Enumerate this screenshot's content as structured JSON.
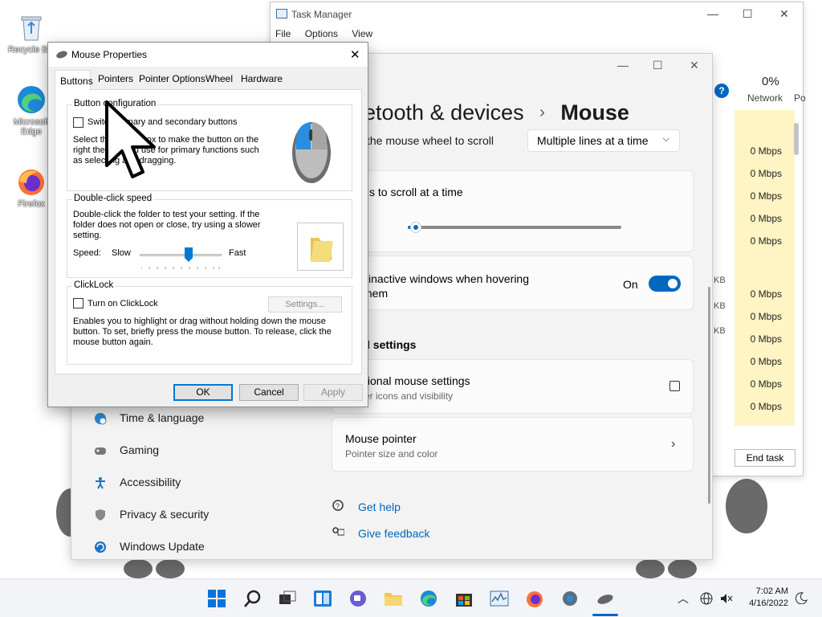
{
  "desktop": {
    "icons": [
      {
        "label": "Recycle Bin",
        "icon": "recycle-bin-icon"
      },
      {
        "label": "Microsoft Edge",
        "icon": "edge-icon"
      },
      {
        "label": "Firefox",
        "icon": "firefox-icon"
      }
    ]
  },
  "task_manager": {
    "title": "Task Manager",
    "menu": [
      "File",
      "Options",
      "View"
    ],
    "network_percent": "0%",
    "network_label": "Network",
    "next_col": "Po",
    "cells": [
      "0 Mbps",
      "0 Mbps",
      "0 Mbps",
      "0 Mbps",
      "0 Mbps",
      "0 Mbps",
      "0 Mbps",
      "0 Mbps",
      "0 Mbps",
      "0 Mbps",
      "0 Mbps"
    ],
    "kb_labels": [
      "KB",
      "KB",
      "KB"
    ],
    "end_task": "End task"
  },
  "settings": {
    "breadcrumb_parent": "etooth & devices",
    "breadcrumb_sep": "›",
    "page_title": "Mouse",
    "scroll_mode_label": "the mouse wheel to scroll",
    "scroll_mode_value": "Multiple lines at a time",
    "lines_label": "s to scroll at a time",
    "lines_slider": 0.05,
    "inactive_label_1": "l inactive windows when hovering",
    "inactive_label_2": "them",
    "inactive_state": "On",
    "related_heading": "l settings",
    "additional_title": "tional mouse settings",
    "additional_sub": "er icons and visibility",
    "pointer_title": "Mouse pointer",
    "pointer_sub": "Pointer size and color",
    "help": "Get help",
    "feedback": "Give feedback",
    "nav": [
      {
        "label": "Time & language",
        "icon": "globe-clock-icon"
      },
      {
        "label": "Gaming",
        "icon": "gamepad-icon"
      },
      {
        "label": "Accessibility",
        "icon": "accessibility-icon"
      },
      {
        "label": "Privacy & security",
        "icon": "shield-icon"
      },
      {
        "label": "Windows Update",
        "icon": "update-icon"
      }
    ],
    "accent": "#0067c0"
  },
  "mouse_props": {
    "title": "Mouse Properties",
    "tabs": [
      "Buttons",
      "Pointers",
      "Pointer Options",
      "Wheel",
      "Hardware"
    ],
    "active_tab": "Buttons",
    "button_config": {
      "label": "Button configuration",
      "checkbox": "Switch primary and secondary buttons",
      "desc": "Select this check box to make the button on the right the one you use for primary functions such as selecting and dragging."
    },
    "double_click": {
      "label": "Double-click speed",
      "desc": "Double-click the folder to test your setting. If the folder does not open or close, try using a slower setting.",
      "speed": "Speed:",
      "slow": "Slow",
      "fast": "Fast",
      "slider": 0.6
    },
    "clicklock": {
      "label": "ClickLock",
      "checkbox": "Turn on ClickLock",
      "settings_btn": "Settings...",
      "desc": "Enables you to highlight or drag without holding down the mouse button. To set, briefly press the mouse button. To release, click the mouse button again."
    },
    "ok": "OK",
    "cancel": "Cancel",
    "apply": "Apply"
  },
  "taskbar": {
    "time": "7:02 AM",
    "date": "4/16/2022"
  }
}
